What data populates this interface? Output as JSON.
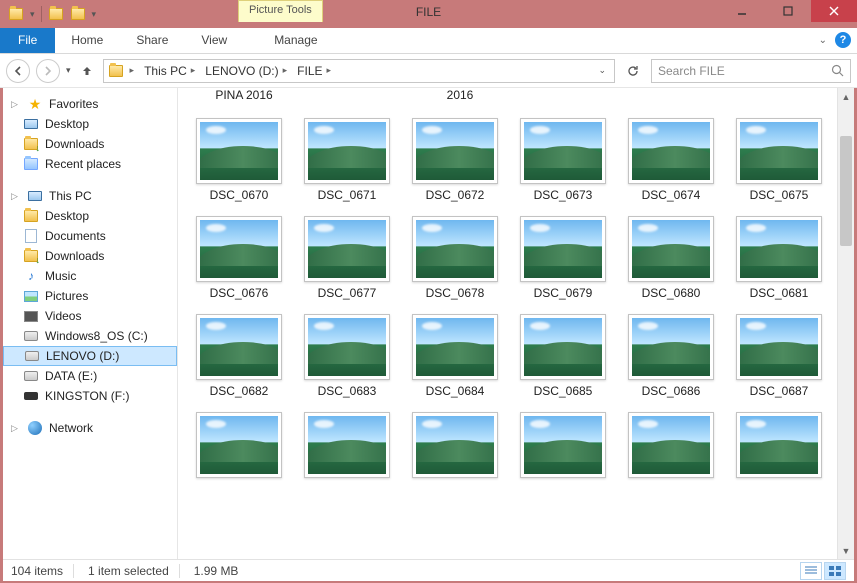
{
  "window": {
    "title": "FILE",
    "tool_tab": "Picture Tools"
  },
  "ribbon": {
    "file": "File",
    "tabs": [
      "Home",
      "Share",
      "View"
    ],
    "manage": "Manage"
  },
  "address": {
    "crumbs": [
      "This PC",
      "LENOVO (D:)",
      "FILE"
    ]
  },
  "search": {
    "placeholder": "Search FILE"
  },
  "nav": {
    "favorites": {
      "label": "Favorites",
      "items": [
        "Desktop",
        "Downloads",
        "Recent places"
      ]
    },
    "thispc": {
      "label": "This PC",
      "items": [
        "Desktop",
        "Documents",
        "Downloads",
        "Music",
        "Pictures",
        "Videos",
        "Windows8_OS (C:)",
        "LENOVO (D:)",
        "DATA (E:)",
        "KINGSTON (F:)"
      ]
    },
    "network": {
      "label": "Network"
    }
  },
  "partial_labels": [
    "PINA 2016",
    "2016"
  ],
  "files": {
    "row1": [
      "DSC_0670",
      "DSC_0671",
      "DSC_0672",
      "DSC_0673",
      "DSC_0674",
      "DSC_0675"
    ],
    "row2": [
      "DSC_0676",
      "DSC_0677",
      "DSC_0678",
      "DSC_0679",
      "DSC_0680",
      "DSC_0681"
    ],
    "row3": [
      "DSC_0682",
      "DSC_0683",
      "DSC_0684",
      "DSC_0685",
      "DSC_0686",
      "DSC_0687"
    ]
  },
  "status": {
    "count": "104 items",
    "selection": "1 item selected",
    "size": "1.99 MB"
  }
}
